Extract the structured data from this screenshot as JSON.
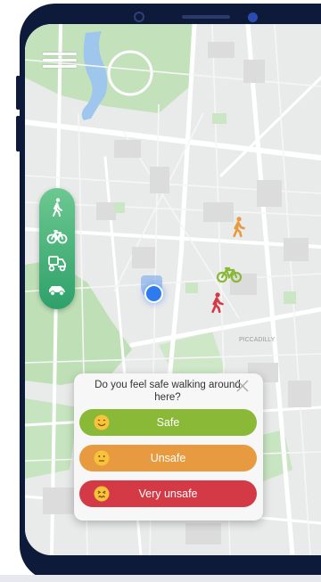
{
  "colors": {
    "frame": "#0d1a3a",
    "mode_bar": "#3fb078",
    "safe": "#8ab837",
    "unsafe": "#e79a3f",
    "very_unsafe": "#d33a45",
    "user_location": "#2e7bee"
  },
  "map": {
    "labels": [
      "PICCADILLY"
    ]
  },
  "menu": {
    "icon": "hamburger-menu-icon"
  },
  "transport_modes": [
    {
      "icon": "walking-icon"
    },
    {
      "icon": "bicycle-icon"
    },
    {
      "icon": "scooter-icon"
    },
    {
      "icon": "car-icon"
    }
  ],
  "markers": [
    {
      "icon": "pedestrian-marker-icon",
      "color": "#e79a3f"
    },
    {
      "icon": "bicycle-marker-icon",
      "color": "#8ab837"
    },
    {
      "icon": "pedestrian-marker-icon",
      "color": "#d33a45"
    }
  ],
  "safety_prompt": {
    "question": "Do you feel safe walking around here?",
    "close_icon": "close-icon",
    "options": [
      {
        "label": "Safe",
        "icon": "smiling-face-icon"
      },
      {
        "label": "Unsafe",
        "icon": "neutral-face-icon"
      },
      {
        "label": "Very unsafe",
        "icon": "distressed-face-icon"
      }
    ]
  }
}
